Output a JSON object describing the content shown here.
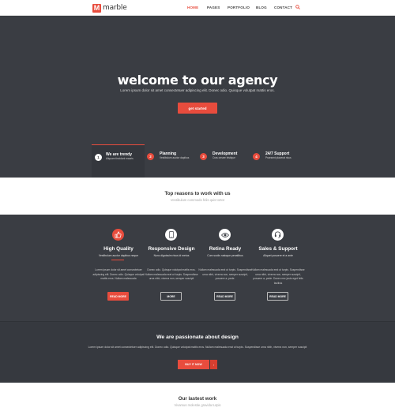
{
  "header": {
    "logo_mark": "M",
    "logo_text": "marble",
    "nav": [
      "HOME",
      "PAGES",
      "PORTFOLIO",
      "BLOG",
      "CONTACT"
    ],
    "active_nav": "HOME"
  },
  "hero": {
    "title": "welcome to our agency",
    "subtitle": "Lorem ipsum dolor sit amet consectetuer adipiscing elit. Donec odio. Quisque volutpat mattis eros.",
    "cta": "get started",
    "steps": [
      {
        "num": "1",
        "title": "We are trendy",
        "desc": "Aliquam tincidunt mauris"
      },
      {
        "num": "2",
        "title": "Planning",
        "desc": "Vestibulum auctor dapibus"
      },
      {
        "num": "3",
        "title": "Development",
        "desc": "Cras ornare tristique"
      },
      {
        "num": "4",
        "title": "24/7 Support",
        "desc": "Praesent placerat risus"
      }
    ]
  },
  "reasons": {
    "title": "Top reasons to work with us",
    "subtitle": "Vestibulum commodo felis quis tortor"
  },
  "features": [
    {
      "icon": "thumbs-up-icon",
      "title": "High Quality",
      "subtitle": "Vestibulum auctor dapibus neque",
      "body": "Lorem ipsum dolor sit amet consectetuer adipiscing elit. Donec odio. Quisque volutpat mattis eros. Nullam malesuada",
      "button": "READ MORE"
    },
    {
      "icon": "tablet-icon",
      "title": "Responsive Design",
      "subtitle": "Nunc dignissim risus id metus",
      "body": "Donec odio. Quisque volutpat mattis eros. Nullam malesuada erat ut turpis. Suspendisse urna nibh, viverra non, semper suscipit",
      "button": "MORE"
    },
    {
      "icon": "eye-icon",
      "title": "Retina Ready",
      "subtitle": "Cum sociis natoque penatibus",
      "body": "Nullam malesuada erat ut turpis. Suspendisse urna nibh, viverra non, semper suscipit, posuere a, pede.",
      "button": "READ MORE"
    },
    {
      "icon": "headset-icon",
      "title": "Sales & Support",
      "subtitle": "Aliquet posuere et a ante",
      "body": "Nullam malesuada erat ut turpis. Suspendisse urna nibh, viverra non, semper suscipit, posuere a, pede. Donec nec justo eget felis facilisis",
      "button": "READ MORE"
    }
  ],
  "passion": {
    "title": "We are passionate about design",
    "body": "Lorem ipsum dolor sit amet consectetuer adipiscing elit. Donec odio. Quisque volutpat mattis eros. Nullam malesuada erat ut turpis. Suspendisse urna nibh, viverra non, semper suscipit",
    "button": "BUY IT NOW",
    "arrow": "›"
  },
  "latest": {
    "title": "Our lastest work",
    "subtitle": "Vivamus molestie gravida turpis"
  },
  "colors": {
    "accent": "#e84c3d",
    "dark": "#3a3d43"
  }
}
